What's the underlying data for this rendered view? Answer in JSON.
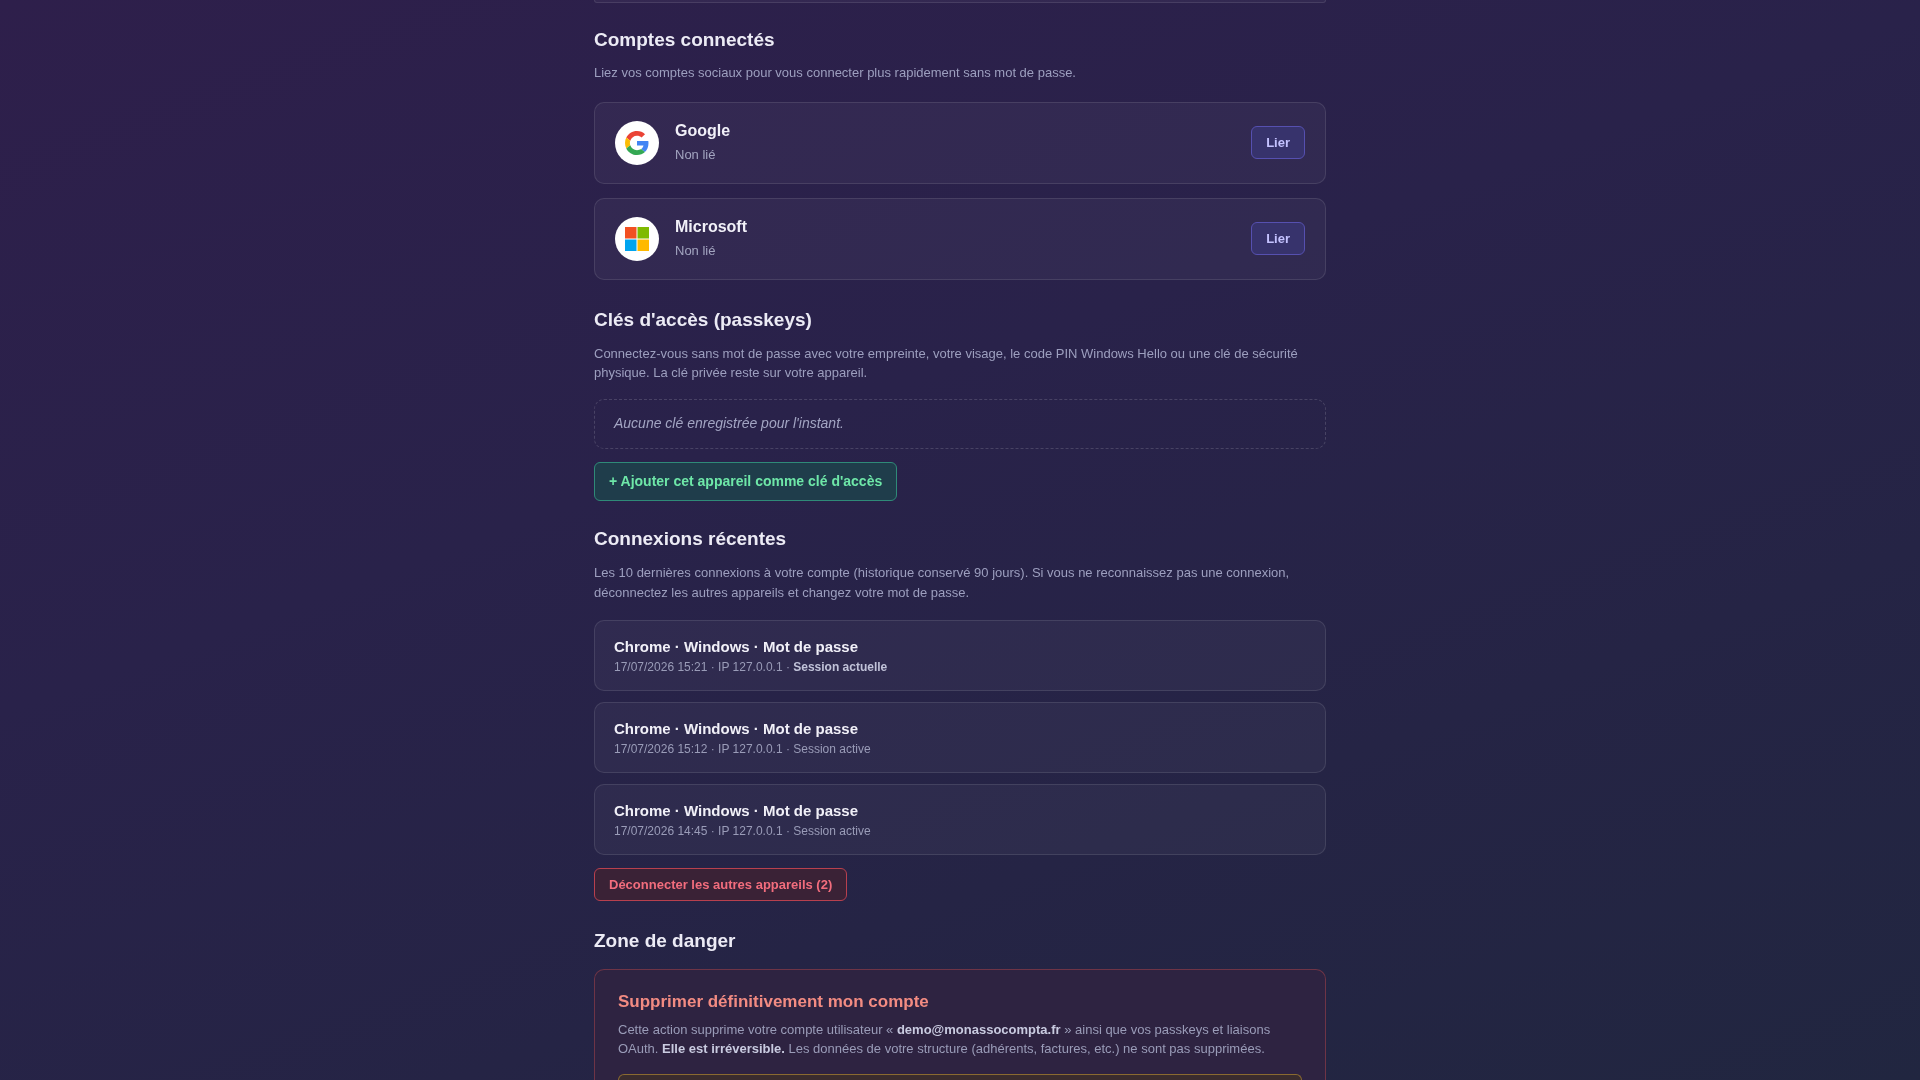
{
  "connected_accounts": {
    "title": "Comptes connectés",
    "description": "Liez vos comptes sociaux pour vous connecter plus rapidement sans mot de passe.",
    "providers": [
      {
        "kind": "google",
        "name": "Google",
        "status": "Non lié",
        "button": "Lier"
      },
      {
        "kind": "microsoft",
        "name": "Microsoft",
        "status": "Non lié",
        "button": "Lier"
      }
    ]
  },
  "passkeys": {
    "title": "Clés d'accès (passkeys)",
    "description": "Connectez-vous sans mot de passe avec votre empreinte, votre visage, le code PIN Windows Hello ou une clé de sécurité physique. La clé privée reste sur votre appareil.",
    "empty_message": "Aucune clé enregistrée pour l'instant.",
    "add_button": "+ Ajouter cet appareil comme clé d'accès"
  },
  "recent_logins": {
    "title": "Connexions récentes",
    "description": "Les 10 dernières connexions à votre compte (historique conservé 90 jours). Si vous ne reconnaissez pas une connexion, déconnectez les autres appareils et changez votre mot de passe.",
    "sessions": [
      {
        "title": "Chrome · Windows · Mot de passe",
        "details": "17/07/2026 15:21 · IP 127.0.0.1 · **Session actuelle**"
      },
      {
        "title": "Chrome · Windows · Mot de passe",
        "details": "17/07/2026 15:12 · IP 127.0.0.1 · Session active"
      },
      {
        "title": "Chrome · Windows · Mot de passe",
        "details": "17/07/2026 14:45 · IP 127.0.0.1 · Session active"
      }
    ],
    "disconnect_button": "Déconnecter les autres appareils (2)"
  },
  "danger_zone": {
    "title": "Zone de danger",
    "card": {
      "title": "Supprimer définitivement mon compte",
      "description": "Cette action supprime votre compte utilisateur « **demo@monassocompta.fr** » ainsi que vos passkeys et liaisons OAuth. **Elle est irréversible.** Les données de votre structure (adhérents, factures, etc.) ne sont pas supprimées."
    }
  }
}
